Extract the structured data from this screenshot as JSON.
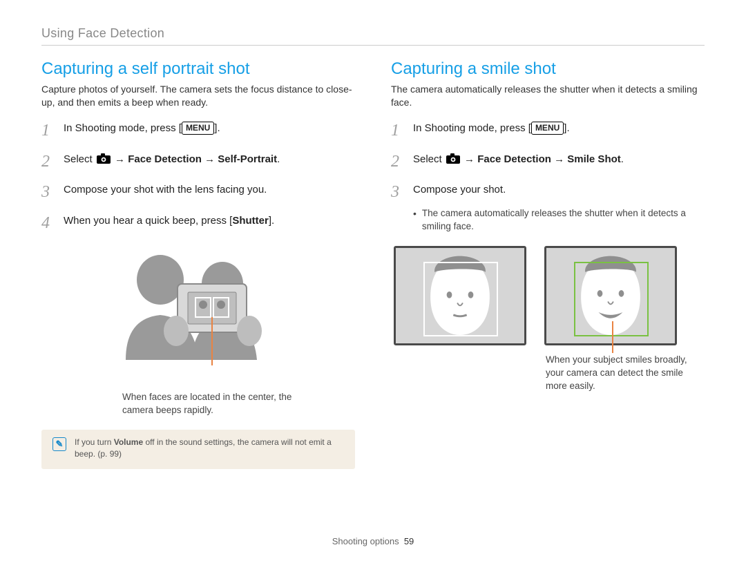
{
  "breadcrumb": "Using Face Detection",
  "left": {
    "heading": "Capturing a self portrait shot",
    "intro": "Capture photos of yourself. The camera sets the focus distance to close-up, and then emits a beep when ready.",
    "steps": {
      "s1_pre": "In Shooting mode, press [",
      "s1_badge": "MENU",
      "s1_post": "].",
      "s2_pre": "Select ",
      "s2_arrow1": " → ",
      "s2_fd": "Face Detection",
      "s2_arrow2": " → ",
      "s2_mode": "Self-Portrait",
      "s2_end": ".",
      "s3": "Compose your shot with the lens facing you.",
      "s4_pre": "When you hear a quick beep, press [",
      "s4_btn": "Shutter",
      "s4_post": "]."
    },
    "callout": "When faces are located in the center, the camera beeps rapidly.",
    "note_pre": "If you turn ",
    "note_bold": "Volume",
    "note_post": " off in the sound settings, the camera will not emit a beep. (p. 99)"
  },
  "right": {
    "heading": "Capturing a smile shot",
    "intro": "The camera automatically releases the shutter when it detects a smiling face.",
    "steps": {
      "s1_pre": "In Shooting mode, press [",
      "s1_badge": "MENU",
      "s1_post": "].",
      "s2_pre": "Select ",
      "s2_arrow1": " → ",
      "s2_fd": "Face Detection",
      "s2_arrow2": " → ",
      "s2_mode": "Smile Shot",
      "s2_end": ".",
      "s3": "Compose your shot.",
      "s3_sub": "The camera automatically releases the shutter when it detects a smiling face."
    },
    "callout": "When your subject smiles broadly, your camera can detect the smile more easily."
  },
  "nums": {
    "n1": "1",
    "n2": "2",
    "n3": "3",
    "n4": "4"
  },
  "footer": {
    "section": "Shooting options",
    "page": "59"
  }
}
